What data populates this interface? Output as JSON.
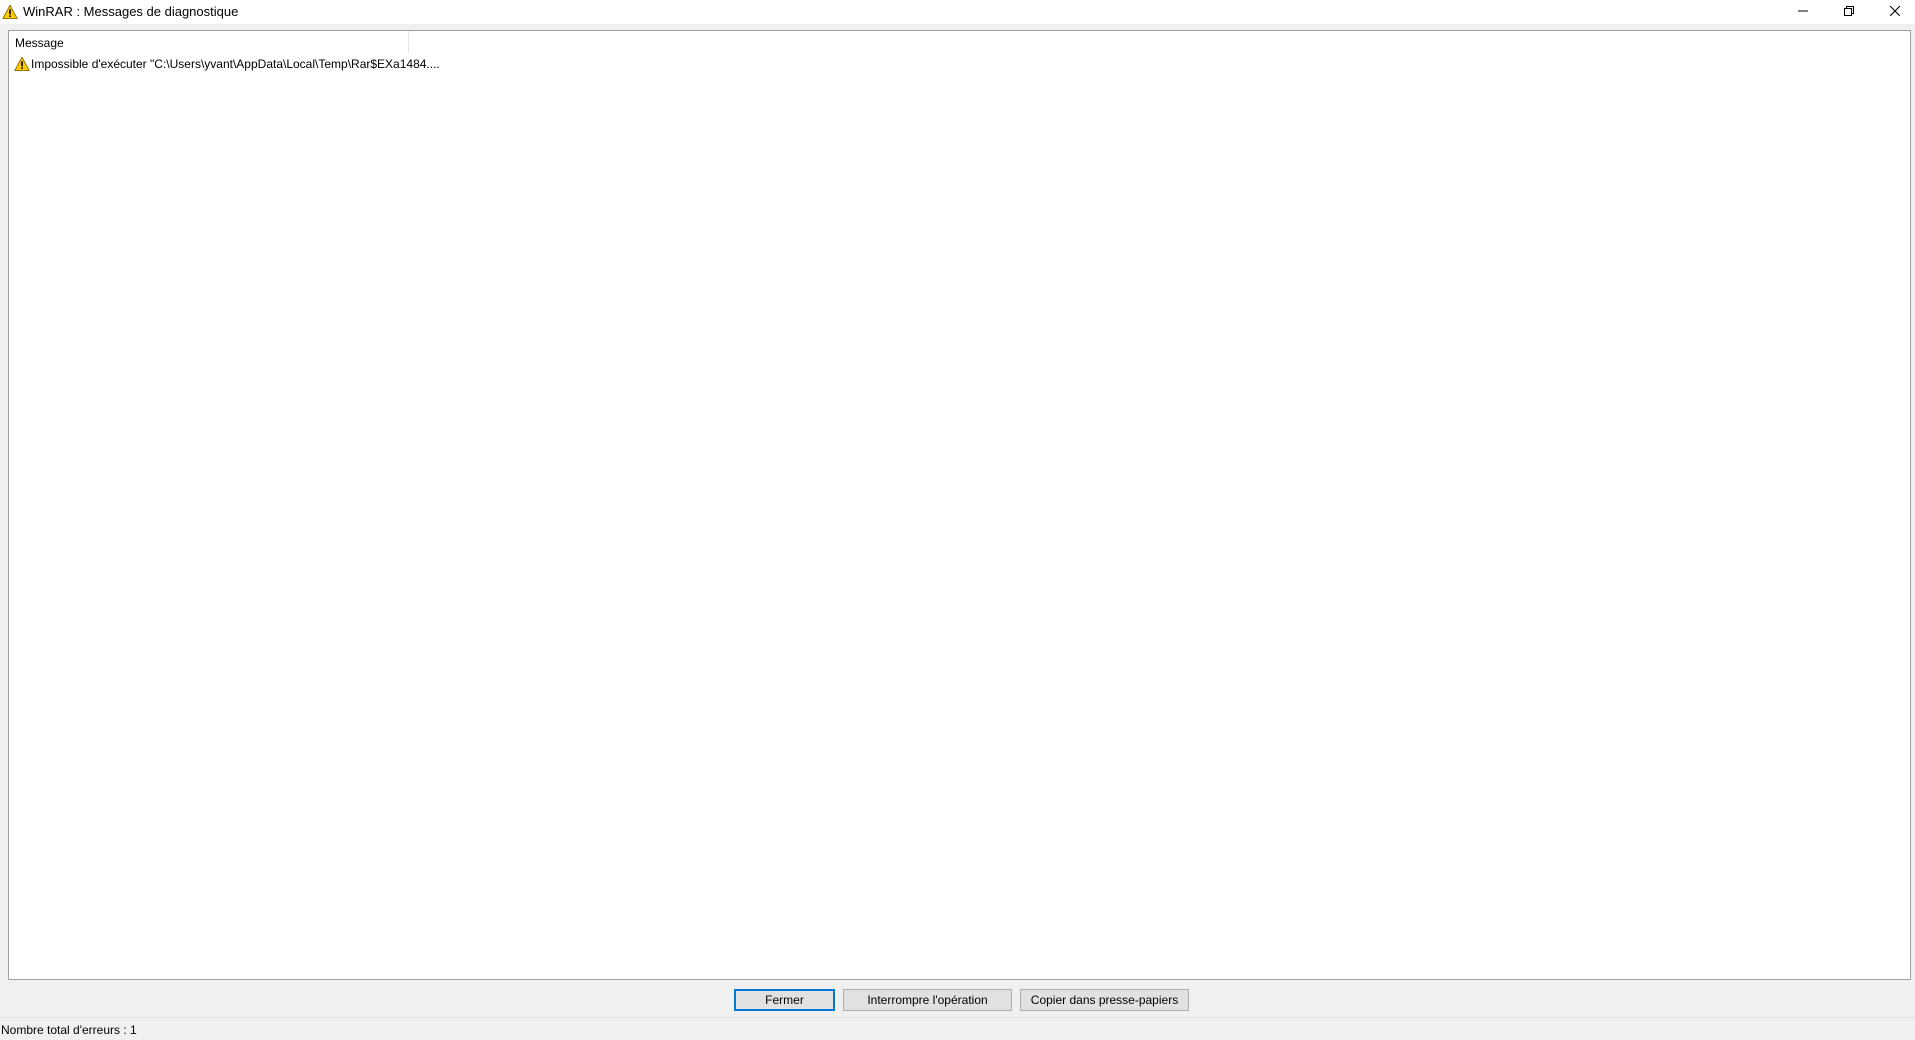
{
  "window": {
    "title": "WinRAR : Messages de diagnostique",
    "title_icon": "warning-icon",
    "controls": {
      "minimize_icon": "minimize-icon",
      "restore_icon": "restore-icon",
      "close_icon": "close-icon"
    }
  },
  "list": {
    "columns": [
      "Message"
    ],
    "rows": [
      {
        "icon": "warning-icon",
        "message": "Impossible d'exécuter \"C:\\Users\\yvant\\AppData\\Local\\Temp\\Rar$EXa1484...."
      }
    ]
  },
  "buttons": {
    "close_label": "Fermer",
    "abort_label": "Interrompre l'opération",
    "copy_label": "Copier dans presse-papiers"
  },
  "status": {
    "text": "Nombre total d'erreurs : 1"
  },
  "colors": {
    "warning_yellow": "#ffcc00",
    "focus_blue": "#0078d7",
    "button_face": "#e1e1e1",
    "window_bg": "#f0f0f0"
  }
}
